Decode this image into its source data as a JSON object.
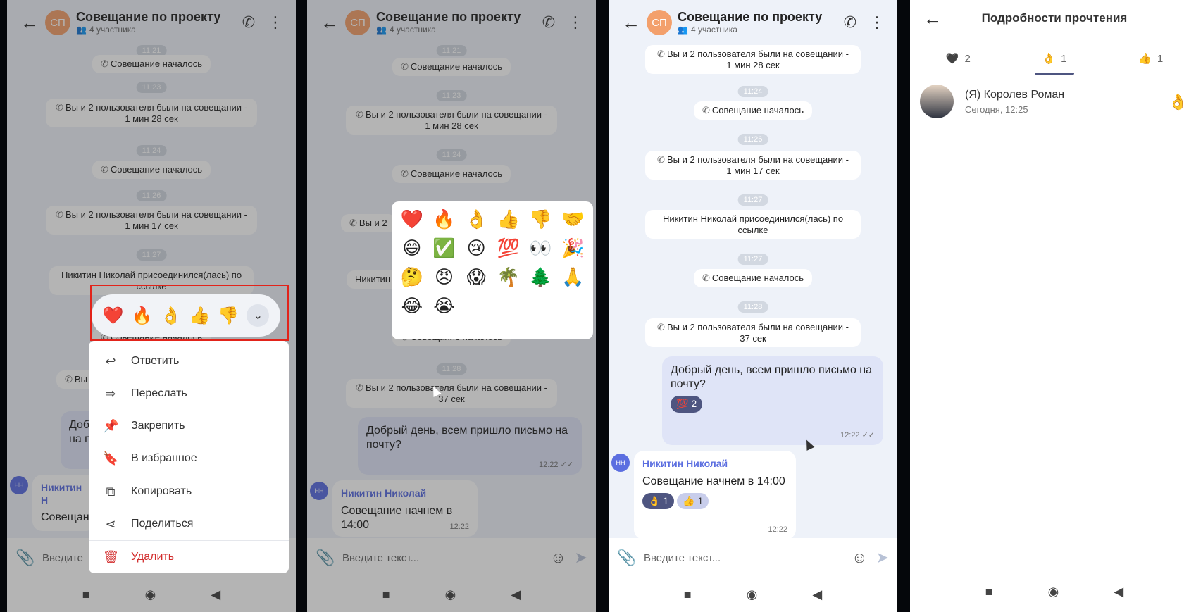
{
  "chat": {
    "avatar_initials": "СП",
    "title": "Совещание по проекту",
    "participants": "4 участника",
    "input_placeholder": "Введите текст..."
  },
  "screen1": {
    "ticks": [
      "11:21",
      "11:23",
      "11:24",
      "11:26",
      "11:27"
    ],
    "sys": [
      "Совещание началось",
      "Вы и 2 пользователя были на совещании - 1 мин 28 сек",
      "Совещание началось",
      "Вы и 2 пользователя были на совещании - 1 мин 17 сек",
      "Никитин Николай присоединился(лась) по ссылке",
      "Совещание началось",
      "Вы и 2"
    ],
    "bubble_out": "Доб на п",
    "sender_initials": "НН",
    "sender_name": "Никитин Н",
    "in_text": "Совещани",
    "input_partial": "Введите",
    "reactions": [
      "❤️",
      "🔥",
      "👌",
      "👍",
      "👎"
    ],
    "menu": [
      "Ответить",
      "Переслать",
      "Закрепить",
      "В избранное",
      "Копировать",
      "Поделиться",
      "Удалить"
    ]
  },
  "screen2": {
    "ticks": [
      "11:21",
      "11:23",
      "11:24",
      "11:28"
    ],
    "sys": [
      "Совещание началось",
      "Вы и 2 пользователя были на совещании - 1 мин 28 сек",
      "Совещание началось",
      "Вы и 2",
      "Никитин",
      "Совещание началось",
      "Вы и 2 пользователя были на совещании - 37 сек"
    ],
    "emoji": [
      "❤️",
      "🔥",
      "👌",
      "👍",
      "👎",
      "🤝",
      "😄",
      "✅",
      "😢",
      "💯",
      "👀",
      "🎉",
      "🤔",
      "😠",
      "😱",
      "🌴",
      "🌲",
      "🙏",
      "😂",
      "😭"
    ],
    "out_text": "Добрый день, всем пришло письмо на почту?",
    "out_time": "12:22",
    "sender_initials": "НН",
    "sender_name": "Никитин Николай",
    "in_text": "Совещание начнем в 14:00",
    "in_time": "12:22"
  },
  "screen3": {
    "ticks": [
      "11:24",
      "11:26",
      "11:27",
      "11:27",
      "11:28"
    ],
    "sys": [
      "Вы и 2 пользователя были на совещании - 1 мин 28 сек",
      "Совещание началось",
      "Вы и 2 пользователя были на совещании - 1 мин 17 сек",
      "Никитин Николай присоединился(лась) по ссылке",
      "Совещание началось",
      "Вы и 2 пользователя были на совещании - 37 сек"
    ],
    "out_text": "Добрый день, всем пришло письмо на почту?",
    "out_time": "12:22",
    "out_reaction_emoji": "💯",
    "out_reaction_count": "2",
    "sender_initials": "НН",
    "sender_name": "Никитин Николай",
    "in_text": "Совещание начнем в 14:00",
    "in_time": "12:22",
    "in_reactions": [
      {
        "emoji": "👌",
        "count": "1"
      },
      {
        "emoji": "👍",
        "count": "1"
      }
    ]
  },
  "screen4": {
    "title": "Подробности прочтения",
    "tabs": [
      {
        "emoji": "🖤",
        "count": "2"
      },
      {
        "emoji": "👌",
        "count": "1"
      },
      {
        "emoji": "👍",
        "count": "1"
      }
    ],
    "user_name": "(Я) Королев Роман",
    "user_date": "Сегодня, 12:25",
    "user_reaction": "👌"
  }
}
